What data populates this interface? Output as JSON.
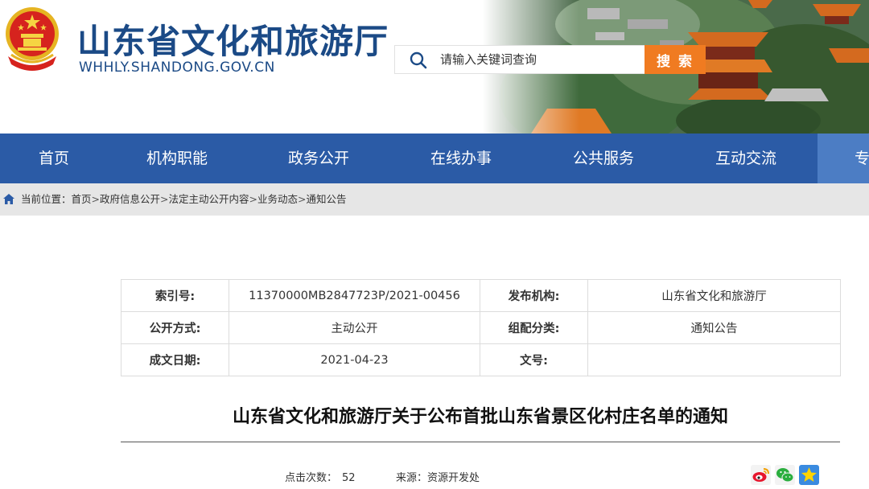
{
  "header": {
    "site_title": "山东省文化和旅游厅",
    "site_url": "WHHLY.SHANDONG.GOV.CN",
    "logo": "national-emblem",
    "banner": "temple-scenery"
  },
  "search": {
    "placeholder": "请输入关键词查询",
    "button_label": "搜 索",
    "button_color": "#f07b21"
  },
  "nav": {
    "background": "#2b5ba6",
    "items": [
      {
        "label": "首页"
      },
      {
        "label": "机构职能"
      },
      {
        "label": "政务公开"
      },
      {
        "label": "在线办事"
      },
      {
        "label": "公共服务"
      },
      {
        "label": "互动交流"
      },
      {
        "label": "专"
      }
    ]
  },
  "breadcrumb": {
    "prefix": "当前位置：",
    "items": [
      "首页",
      "政府信息公开",
      "法定主动公开内容",
      "业务动态",
      "通知公告"
    ],
    "separator": ">"
  },
  "info": {
    "index_label": "索引号:",
    "index_value": "11370000MB2847723P/2021-00456",
    "publisher_label": "发布机构:",
    "publisher_value": "山东省文化和旅游厅",
    "disclosure_label": "公开方式:",
    "disclosure_value": "主动公开",
    "category_label": "组配分类:",
    "category_value": "通知公告",
    "date_label": "成文日期:",
    "date_value": "2021-04-23",
    "docno_label": "文号:",
    "docno_value": ""
  },
  "article": {
    "title": "山东省文化和旅游厅关于公布首批山东省景区化村庄名单的通知",
    "views_label": "点击次数：",
    "views_value": "52",
    "source_label": "来源：",
    "source_value": "资源开发处"
  },
  "share": [
    "weibo-icon",
    "wechat-icon",
    "qzone-icon"
  ]
}
